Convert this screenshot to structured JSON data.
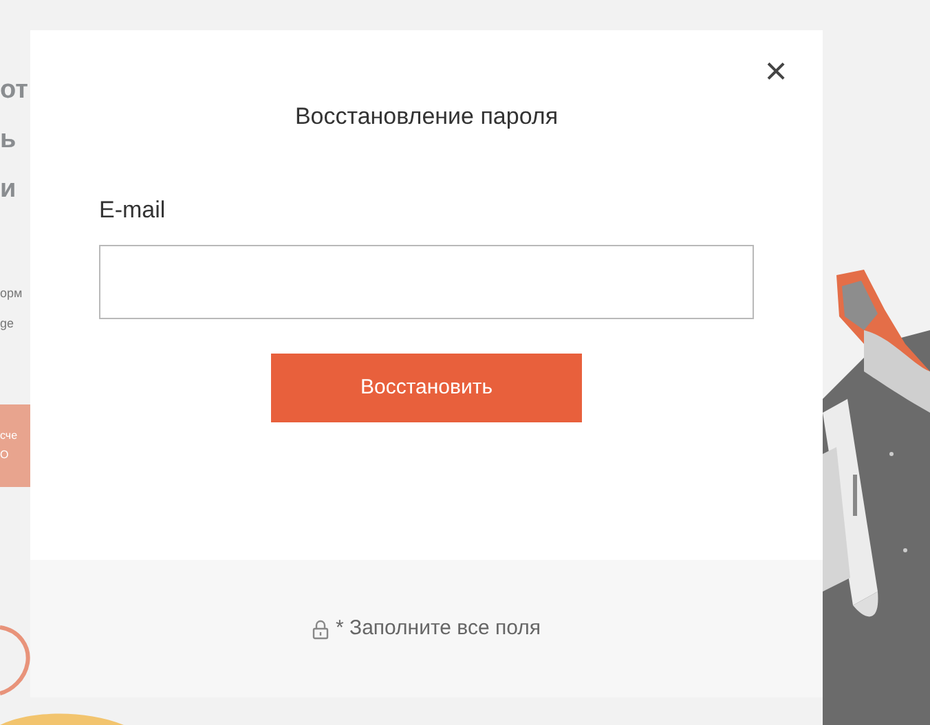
{
  "background": {
    "fragments": [
      {
        "kind": "heading",
        "text": "от"
      },
      {
        "kind": "heading",
        "text": "ь"
      },
      {
        "kind": "heading",
        "text": "и"
      },
      {
        "kind": "body",
        "text": "орм"
      },
      {
        "kind": "body",
        "text": "ge"
      }
    ],
    "button_lines": [
      "сче",
      "О"
    ]
  },
  "modal": {
    "title": "Восстановление пароля",
    "close": "×",
    "field": {
      "label": "E-mail"
    },
    "submit": "Восстановить",
    "footer_note": "* Заполните все поля"
  }
}
